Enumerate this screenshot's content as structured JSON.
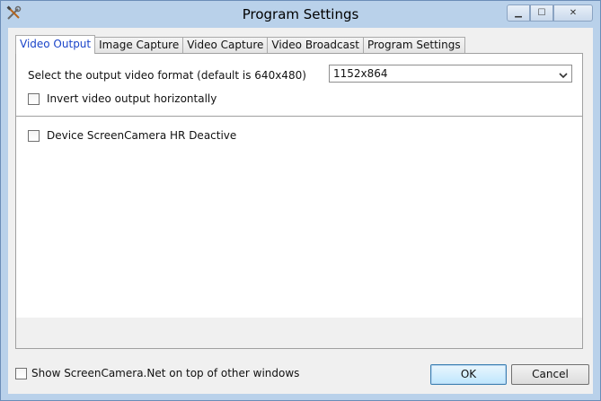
{
  "window": {
    "title": "Program Settings"
  },
  "caption": {
    "minimize": "▁",
    "maximize": "☐",
    "close": "✕"
  },
  "tabs": [
    {
      "label": "Video Output"
    },
    {
      "label": "Image Capture"
    },
    {
      "label": "Video Capture"
    },
    {
      "label": "Video Broadcast"
    },
    {
      "label": "Program Settings"
    }
  ],
  "video_output": {
    "format_label": "Select the output video format (default is 640x480)",
    "format_value": "1152x864",
    "invert_label": "Invert video output horizontally",
    "invert_checked": false,
    "device_label": "Device ScreenCamera HR Deactive",
    "device_checked": false
  },
  "footer": {
    "ontop_label": "Show ScreenCamera.Net on top of other windows",
    "ontop_checked": false,
    "ok_label": "OK",
    "cancel_label": "Cancel"
  },
  "colors": {
    "titlebar": "#b9d1ea",
    "active_tab_text": "#1a44c9"
  }
}
